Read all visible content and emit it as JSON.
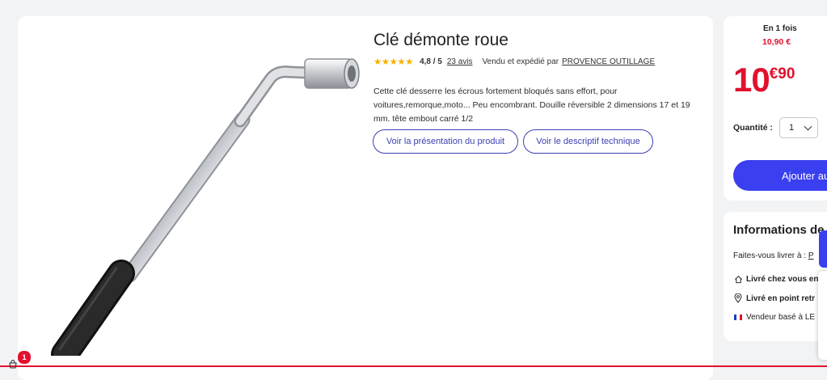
{
  "product": {
    "title": "Clé démonte roue",
    "rating_stars": "★★★★★",
    "rating_score": "4,8 / 5",
    "reviews_link": "23 avis",
    "seller_prefix": "Vendu et expédié par",
    "seller_name": "PROVENCE OUTILLAGE",
    "description": "Cette clé desserre les écrous fortement bloqués sans effort, pour voitures,remorque,moto... Peu encombrant. Douille réversible 2 dimensions 17 et 19 mm. tête embout carré 1/2",
    "btn_presentation": "Voir la présentation du produit",
    "btn_descriptif": "Voir le descriptif technique"
  },
  "purchase": {
    "payment_label": "En 1 fois",
    "payment_amount": "10,90 €",
    "price_whole": "10",
    "price_cents": "€90",
    "quantity_label": "Quantité :",
    "quantity_value": "1",
    "add_button": "Ajouter au"
  },
  "info": {
    "title": "Informations de",
    "delivery_prefix": "Faites-vous livrer à :",
    "delivery_link": "P",
    "home_delivery": "Livré chez vous en",
    "pickup": "Livré en point retr",
    "seller_location": "Vendeur basé à LE"
  },
  "cart": {
    "badge_count": "1"
  },
  "colors": {
    "accent_blue": "#3a3ff0",
    "price_red": "#e1112e",
    "star_yellow": "#f5b300"
  },
  "icons": [
    "star-icon",
    "chevron-down-icon",
    "home-icon",
    "location-pin-icon",
    "france-flag-icon",
    "cart-icon"
  ]
}
